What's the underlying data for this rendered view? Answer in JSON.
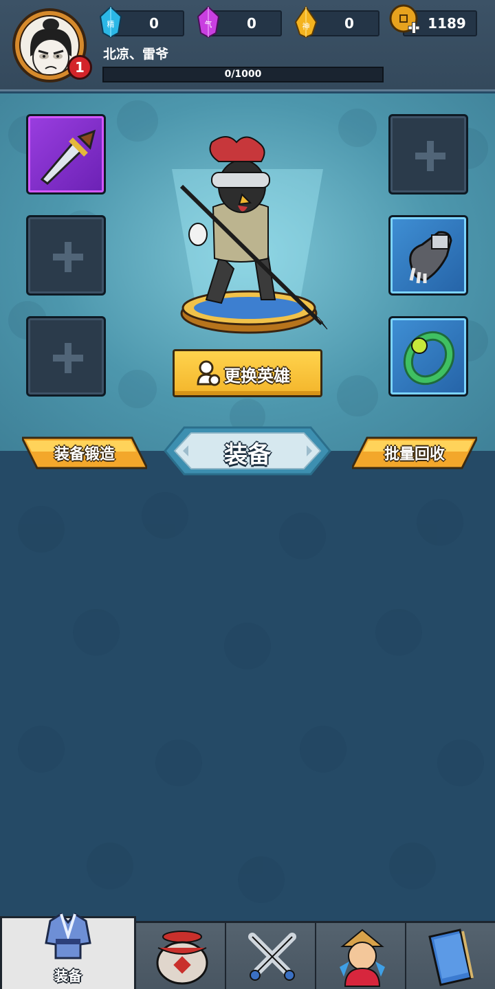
{
  "player": {
    "name": "北凉、雷爷",
    "level": "1",
    "exp_text": "0/1000",
    "exp_progress": 0
  },
  "resources": [
    {
      "id": "jing",
      "icon_label": "精",
      "value": "0",
      "color": "#2bb7e6"
    },
    {
      "id": "qi",
      "icon_label": "气",
      "value": "0",
      "color": "#c93fe0"
    },
    {
      "id": "shen",
      "icon_label": "神",
      "value": "0",
      "color": "#f4b31f"
    },
    {
      "id": "coin",
      "icon_label": "",
      "value": "1189",
      "color": "#e7a21e"
    }
  ],
  "equipment_slots": {
    "left": [
      {
        "state": "equipped",
        "item": "dagger-icon",
        "rarity": "purple"
      },
      {
        "state": "empty"
      },
      {
        "state": "empty"
      }
    ],
    "right": [
      {
        "state": "empty"
      },
      {
        "state": "equipped",
        "item": "gauntlet-icon",
        "rarity": "blue"
      },
      {
        "state": "equipped",
        "item": "jade-bracelet-icon",
        "rarity": "blue"
      }
    ]
  },
  "actions": {
    "change_hero": "更换英雄",
    "forge": "装备锻造",
    "recycle": "批量回收"
  },
  "section_title": "装备",
  "bottom_nav": [
    {
      "id": "equipment",
      "label": "装备",
      "icon": "robe-icon",
      "active": true
    },
    {
      "id": "tavern",
      "label": "",
      "icon": "wine-jar-icon",
      "active": false
    },
    {
      "id": "battle",
      "label": "",
      "icon": "crossed-swords-icon",
      "active": false
    },
    {
      "id": "hero",
      "label": "",
      "icon": "hero-portrait-icon",
      "active": false
    },
    {
      "id": "book",
      "label": "",
      "icon": "book-icon",
      "active": false
    }
  ],
  "colors": {
    "background": "#254a66",
    "header": "#34495c",
    "accent_button": "#f3b52b"
  }
}
